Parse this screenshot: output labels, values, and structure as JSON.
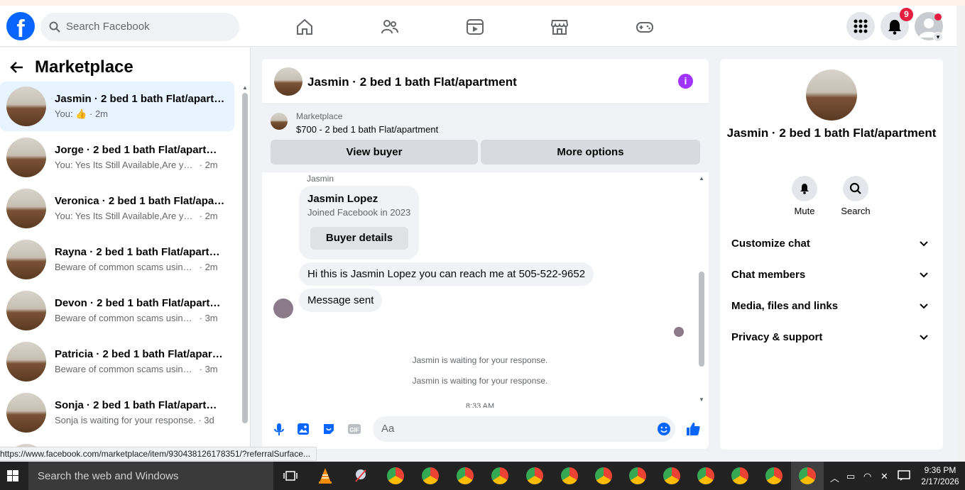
{
  "header": {
    "search_placeholder": "Search Facebook",
    "notifications_count": "9",
    "brand_color": "#0866ff",
    "nav_icons": [
      "home-icon",
      "friends-icon",
      "video-icon",
      "marketplace-icon",
      "gaming-icon"
    ]
  },
  "sidebar": {
    "title": "Marketplace",
    "conversations": [
      {
        "name": "Jasmin · 2 bed 1 bath Flat/apartment",
        "snippet": "You:",
        "time": "2m",
        "liked": true
      },
      {
        "name": "Jorge · 2 bed 1 bath Flat/apartment",
        "snippet": "You: Yes Its Still Available,Are you i...",
        "time": "2m"
      },
      {
        "name": "Veronica · 2 bed 1 bath Flat/apartment",
        "snippet": "You: Yes Its Still Available,Are you i...",
        "time": "2m"
      },
      {
        "name": "Rayna · 2 bed 1 bath Flat/apartment",
        "snippet": "Beware of common scams using p...",
        "time": "2m"
      },
      {
        "name": "Devon · 2 bed 1 bath Flat/apartment",
        "snippet": "Beware of common scams using p...",
        "time": "3m"
      },
      {
        "name": "Patricia · 2 bed 1 bath Flat/apartment",
        "snippet": "Beware of common scams using p...",
        "time": "3m"
      },
      {
        "name": "Sonja · 2 bed 1 bath Flat/apartment",
        "snippet": "Sonja is waiting for your response.",
        "time": "3d"
      }
    ]
  },
  "chat": {
    "title": "Jasmin · 2 bed 1 bath Flat/apartment",
    "marketplace_label": "Marketplace",
    "listing": "$700 - 2 bed 1 bath Flat/apartment",
    "view_buyer": "View buyer",
    "more_options": "More options",
    "sender": "Jasmin",
    "buyer_name": "Jasmin Lopez",
    "buyer_joined": "Joined Facebook in 2023",
    "buyer_details": "Buyer details",
    "message_1": "Hi this is Jasmin Lopez you can reach me at 505-522-9652",
    "message_2": "Message sent",
    "system_1": "Jasmin is waiting for your response.",
    "system_2": "Jasmin is waiting for your response.",
    "timestamp": "8:33 AM",
    "composer_placeholder": "Aa"
  },
  "details": {
    "title": "Jasmin · 2 bed 1 bath Flat/apartment",
    "mute": "Mute",
    "search": "Search",
    "sections": [
      "Customize chat",
      "Chat members",
      "Media, files and links",
      "Privacy & support"
    ]
  },
  "status_url": "https://www.facebook.com/marketplace/item/930438126178351/?referralSurface...",
  "taskbar": {
    "search_placeholder": "Search the web and Windows",
    "time": "9:36 PM",
    "date": "2/17/2026"
  }
}
